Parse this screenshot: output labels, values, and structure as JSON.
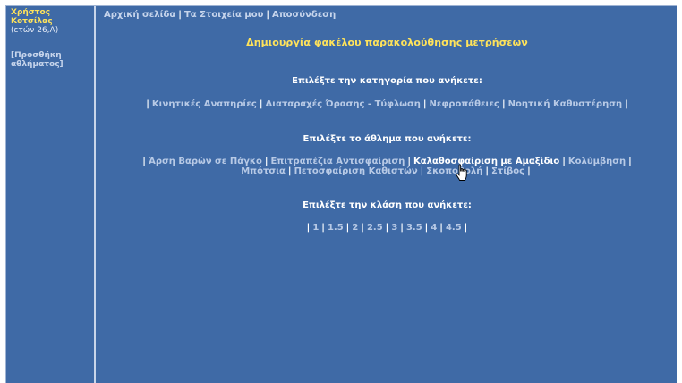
{
  "sidebar": {
    "user_name_line1": "Χρήστος",
    "user_name_line2": "Κοτσίλας",
    "user_meta": "(ετών 26,Α)",
    "add_sport_line1": "[Προσθήκη",
    "add_sport_line2": "αθλήματος]"
  },
  "topnav": {
    "home": "Αρχική σελίδα",
    "my_data": "Τα Στοιχεία μου",
    "logout": "Αποσύνδεση"
  },
  "page_title": "Δημιουργία φακέλου παρακολούθησης μετρήσεων",
  "category_section": {
    "heading": "Επιλέξτε την κατηγορία που ανήκετε:",
    "options": [
      "Κινητικές Αναπηρίες",
      "Διαταραχές Όρασης - Τύφλωση",
      "Νεφροπάθειες",
      "Νοητική Καθυστέρηση"
    ]
  },
  "sport_section": {
    "heading": "Επιλέξτε το άθλημα που ανήκετε:",
    "options": [
      "Άρση Βαρών σε Πάγκο",
      "Επιτραπέζια Αντισφαίριση",
      "Καλαθοσφαίριση με Αμαξίδιο",
      "Κολύμβηση",
      "Μπότσια",
      "Πετοσφαίριση Καθιστών",
      "Σκοποβολή",
      "Στίβος"
    ],
    "active_option": "Καλαθοσφαίριση με Αμαξίδιο"
  },
  "class_section": {
    "heading": "Επιλέξτε την κλάση που ανήκετε:",
    "options": [
      "1",
      "1.5",
      "2",
      "2.5",
      "3",
      "3.5",
      "4",
      "4.5"
    ]
  },
  "separator": "|",
  "icons": {
    "cursor": "hand-pointer-icon"
  },
  "colors": {
    "background": "#3f6aa6",
    "title": "#ffe35a",
    "link": "#b8cae6",
    "text": "#ffffff"
  }
}
